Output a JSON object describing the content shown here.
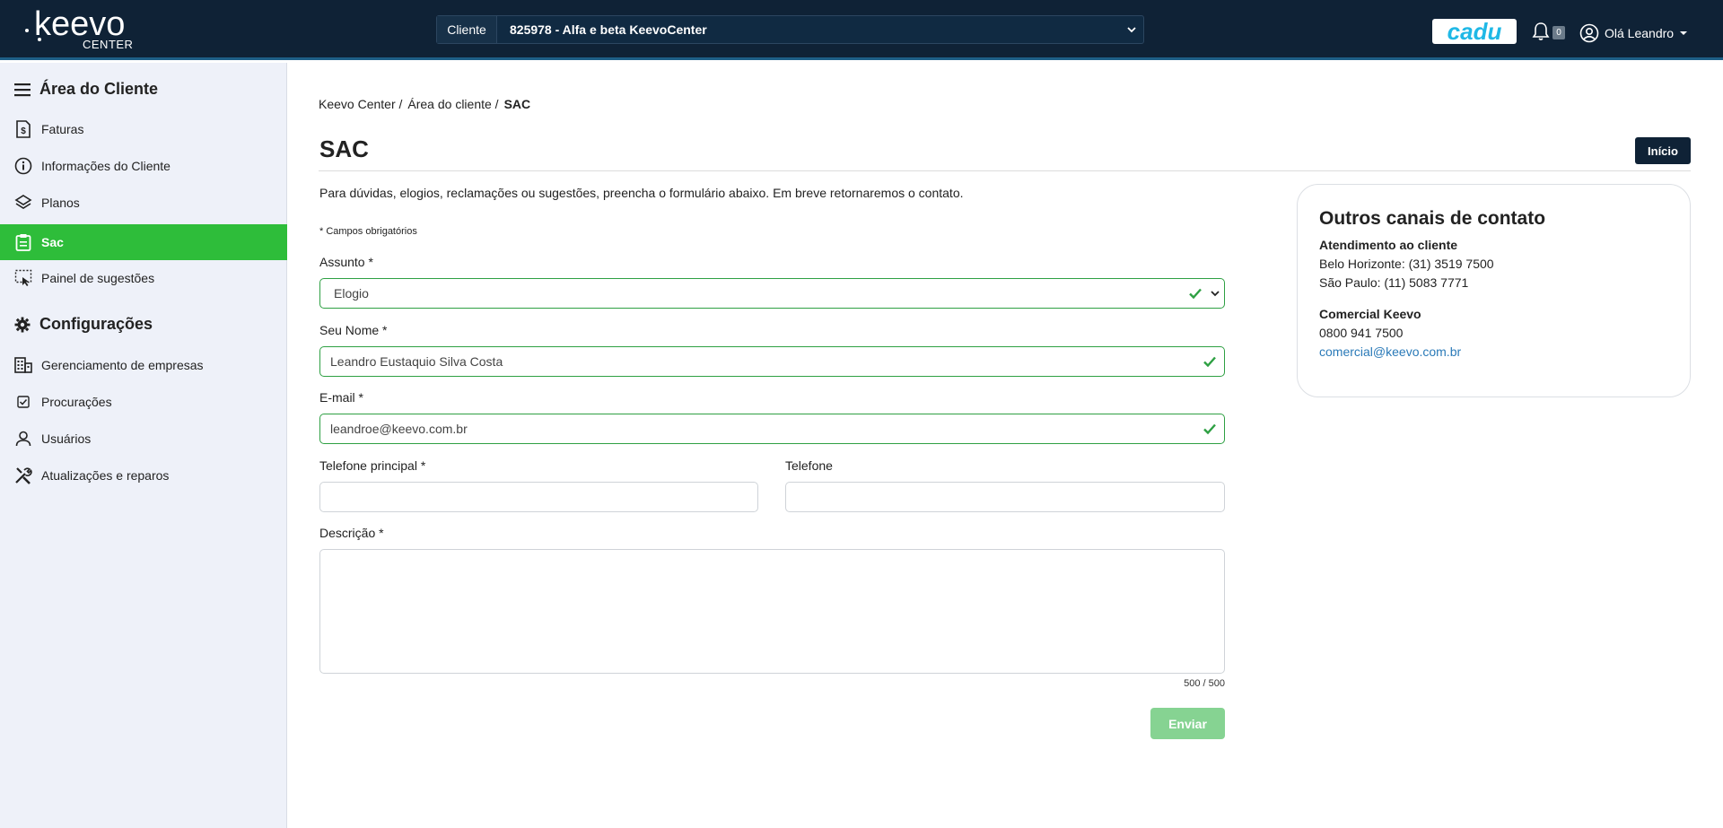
{
  "header": {
    "logo_text": "keevo",
    "logo_sub": "CENTER",
    "client_label": "Cliente",
    "client_value": "825978 - Alfa e beta KeevoCenter",
    "cadu_label": "cadu",
    "notification_count": "0",
    "user_greeting": "Olá Leandro"
  },
  "sidebar": {
    "section1_title": "Área do Cliente",
    "section1_items": [
      {
        "label": "Faturas",
        "icon": "invoice-icon"
      },
      {
        "label": "Informações do Cliente",
        "icon": "info-icon"
      },
      {
        "label": "Planos",
        "icon": "layers-icon"
      },
      {
        "label": "Sac",
        "icon": "clipboard-icon",
        "active": true
      },
      {
        "label": "Painel de sugestões",
        "icon": "suggestions-icon"
      }
    ],
    "section2_title": "Configurações",
    "section2_items": [
      {
        "label": "Gerenciamento de empresas",
        "icon": "building-icon"
      },
      {
        "label": "Procurações",
        "icon": "checkbox-icon"
      },
      {
        "label": "Usuários",
        "icon": "user-icon"
      },
      {
        "label": "Atualizações e reparos",
        "icon": "tools-icon"
      }
    ]
  },
  "breadcrumb": {
    "items": [
      "Keevo Center /",
      "Área do cliente /"
    ],
    "current": "SAC"
  },
  "page": {
    "title": "SAC",
    "home_button": "Início",
    "intro": "Para dúvidas, elogios, reclamações ou sugestões, preencha o formulário abaixo. Em breve retornaremos o contato.",
    "required_note": "* Campos obrigatórios"
  },
  "form": {
    "subject_label": "Assunto *",
    "subject_value": "Elogio",
    "name_label": "Seu Nome *",
    "name_value": "Leandro Eustaquio Silva Costa",
    "email_label": "E-mail *",
    "email_value": "leandroe@keevo.com.br",
    "phone_main_label": "Telefone principal *",
    "phone_main_value": "",
    "phone_label": "Telefone",
    "phone_value": "",
    "description_label": "Descrição *",
    "description_value": "",
    "counter": "500 / 500",
    "submit_label": "Enviar"
  },
  "contact": {
    "title": "Outros canais de contato",
    "support_heading": "Atendimento ao cliente",
    "support_bh": "Belo Horizonte: (31) 3519 7500",
    "support_sp": "São Paulo: (11) 5083 7771",
    "commercial_heading": "Comercial Keevo",
    "commercial_phone": "0800 941 7500",
    "commercial_email": "comercial@keevo.com.br"
  },
  "colors": {
    "topbar": "#0f2236",
    "active_item": "#2ebd3a",
    "valid_border": "#2ea043",
    "submit_disabled": "#86d392",
    "link": "#2a7ab8"
  }
}
